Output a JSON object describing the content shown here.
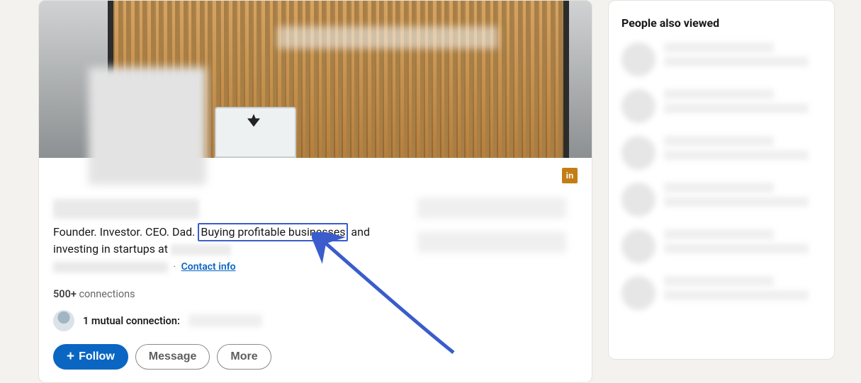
{
  "profile": {
    "headline_prefix": "Founder. Investor. CEO. Dad.",
    "highlighted_phrase": "Buying profitable businesses",
    "headline_middle": "and investing in startups at",
    "contact_info_label": "Contact info",
    "connections_count": "500+",
    "connections_word": "connections",
    "mutual_text": "1 mutual connection:"
  },
  "actions": {
    "follow": "Follow",
    "message": "Message",
    "more": "More"
  },
  "sidebar": {
    "title": "People also viewed"
  },
  "icons": {
    "linkedin": "in"
  }
}
